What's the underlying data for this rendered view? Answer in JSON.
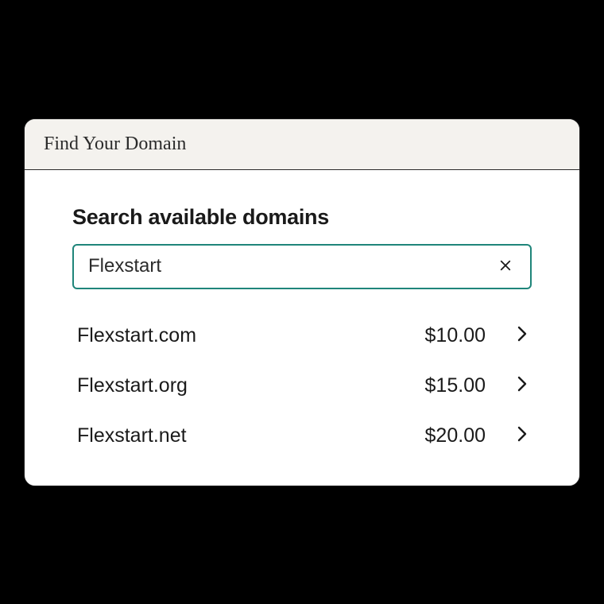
{
  "window": {
    "title": "Find Your Domain"
  },
  "search": {
    "heading": "Search available domains",
    "value": "Flexstart"
  },
  "results": [
    {
      "name": "Flexstart.com",
      "price": "$10.00"
    },
    {
      "name": "Flexstart.org",
      "price": "$15.00"
    },
    {
      "name": "Flexstart.net",
      "price": "$20.00"
    }
  ]
}
